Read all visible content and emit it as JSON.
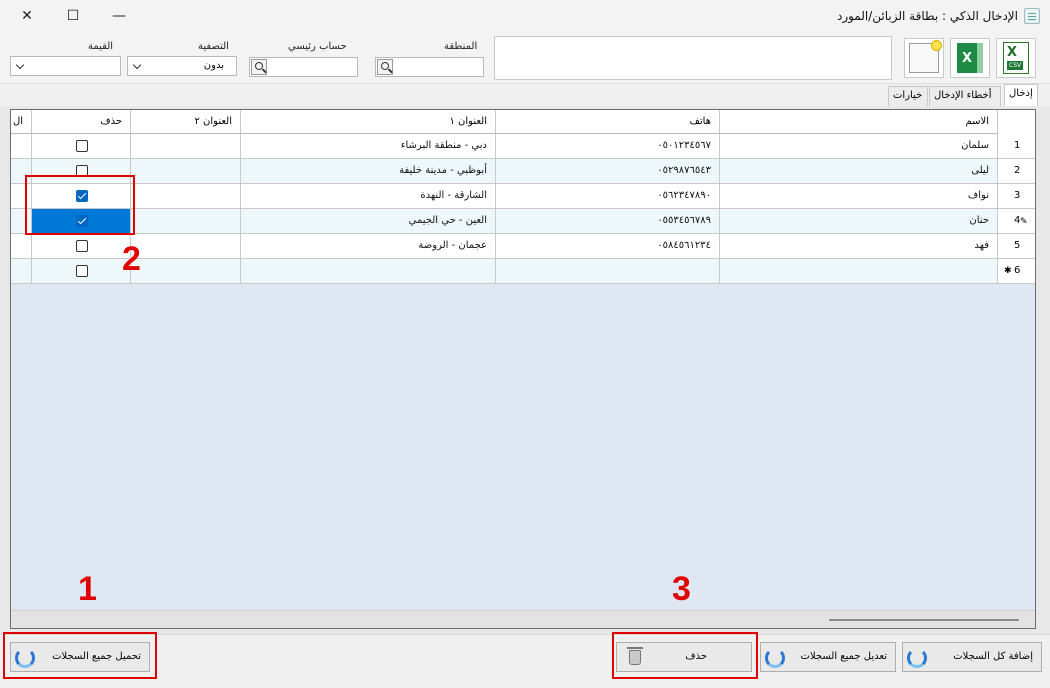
{
  "window": {
    "title": "الإدخال الذكي : بطاقة الزبائن/المورد",
    "close_glyph": "✕",
    "maximize_glyph": "☐",
    "minimize_glyph": "—"
  },
  "filters": {
    "region_label": "المنطقة",
    "region_value": "",
    "main_account_label": "حساب رئيسي",
    "main_account_value": "",
    "filter_label": "التصفية",
    "filter_value": "بدون",
    "value_label": "القيمة",
    "value_value": ""
  },
  "tabs": [
    {
      "label": "إدخال",
      "active": true
    },
    {
      "label": "أخطاء الإدخال",
      "active": false
    },
    {
      "label": "خيارات",
      "active": false
    }
  ],
  "grid": {
    "columns": {
      "name": "الاسم",
      "phone": "هاتف",
      "address1": "العنوان ١",
      "address2": "العنوان ٢",
      "delete": "حذف",
      "extra": "ال"
    },
    "rows": [
      {
        "num": "1",
        "name": "سلمان",
        "phone": "٠٥٠١٢٣٤٥٦٧",
        "address1": "دبي - منطقة البرشاء",
        "address2": "",
        "delete": false
      },
      {
        "num": "2",
        "name": "ليلى",
        "phone": "٠٥٢٩٨٧٦٥٤٣",
        "address1": "أبوظبي - مدينة خليفة",
        "address2": "",
        "delete": false
      },
      {
        "num": "3",
        "name": "نواف",
        "phone": "٠٥٦٢٣٤٧٨٩٠",
        "address1": "الشارقة - النهدة",
        "address2": "",
        "delete": true
      },
      {
        "num": "4",
        "name": "حنان",
        "phone": "٠٥٥٣٤٥٦٧٨٩",
        "address1": "العين - حي الجيمي",
        "address2": "",
        "delete": true
      },
      {
        "num": "5",
        "name": "فهد",
        "phone": "٠٥٨٤٥٦١٢٣٤",
        "address1": "عجمان - الروضة",
        "address2": "",
        "delete": false
      },
      {
        "num": "6",
        "name": "",
        "phone": "",
        "address1": "",
        "address2": "",
        "delete": false
      }
    ],
    "edit_marker": "✎",
    "new_marker": "✱"
  },
  "buttons": {
    "add_all": "إضافة كل السجلات",
    "edit_all": "تعديل جميع السجلات",
    "delete": "حذف",
    "load_all": "تحميل جميع السجلات"
  },
  "annotations": [
    "1",
    "2",
    "3"
  ],
  "colors": {
    "accent": "#0078d7",
    "annotation": "#e00000"
  },
  "icons": {
    "csv": "csv-export-icon",
    "excel": "excel-icon",
    "new": "new-document-icon",
    "file_tag": "CSV",
    "excel_letter": "X"
  }
}
